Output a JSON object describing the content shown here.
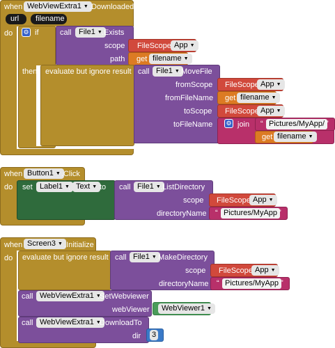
{
  "block1": {
    "when": "when",
    "component": "WebViewExtra1",
    "event": ".Downloaded",
    "params": [
      "url",
      "filename"
    ],
    "do": "do",
    "if": "if",
    "then": "then",
    "call": "call",
    "file_component": "File1",
    "exists": ".Exists",
    "scope_label": "scope",
    "path_label": "path",
    "filescope": "FileScope",
    "app": "App",
    "get": "get",
    "filename_var": "filename",
    "evaluate": "evaluate but ignore result",
    "movefile": ".MoveFile",
    "fromScope": "fromScope",
    "fromFileName": "fromFileName",
    "toScope": "toScope",
    "toFileName": "toFileName",
    "join": "join",
    "pictures_myapp_slash": "Pictures/MyApp/"
  },
  "block2": {
    "when": "when",
    "component": "Button1",
    "event": ".Click",
    "do": "do",
    "set": "set",
    "label_comp": "Label1",
    "text_prop": "Text",
    "to": "to",
    "call": "call",
    "file_component": "File1",
    "listdir": ".ListDirectory",
    "scope_label": "scope",
    "filescope": "FileScope",
    "app": "App",
    "directoryName": "directoryName",
    "pictures_myapp": "Pictures/MyApp"
  },
  "block3": {
    "when": "when",
    "component": "Screen3",
    "event": ".Initialize",
    "do": "do",
    "evaluate": "evaluate but ignore result",
    "call": "call",
    "file_component": "File1",
    "makedir": ".MakeDirectory",
    "scope_label": "scope",
    "filescope": "FileScope",
    "app": "App",
    "directoryName": "directoryName",
    "pictures_myapp": "Pictures/MyApp",
    "webview_comp": "WebViewExtra1",
    "setwebviewer": ".SetWebviewer",
    "webViewer_label": "webViewer",
    "webviewer1": "WebViewer1",
    "downloadto": ".DownloadTo",
    "dir_label": "dir",
    "dir_value": "3"
  },
  "colors": {
    "event_gold": "#b48e2c",
    "procedure_purple": "#7c4f9b",
    "filescope_red": "#d1493c",
    "variable_orange": "#dc7b23",
    "text_magenta": "#b8306a",
    "setter_green": "#2f6b3c",
    "component_green": "#4a9c5a",
    "number_blue": "#3a7ac8"
  },
  "icons": [
    "mutator-gear-icon",
    "dropdown-arrow-icon"
  ]
}
